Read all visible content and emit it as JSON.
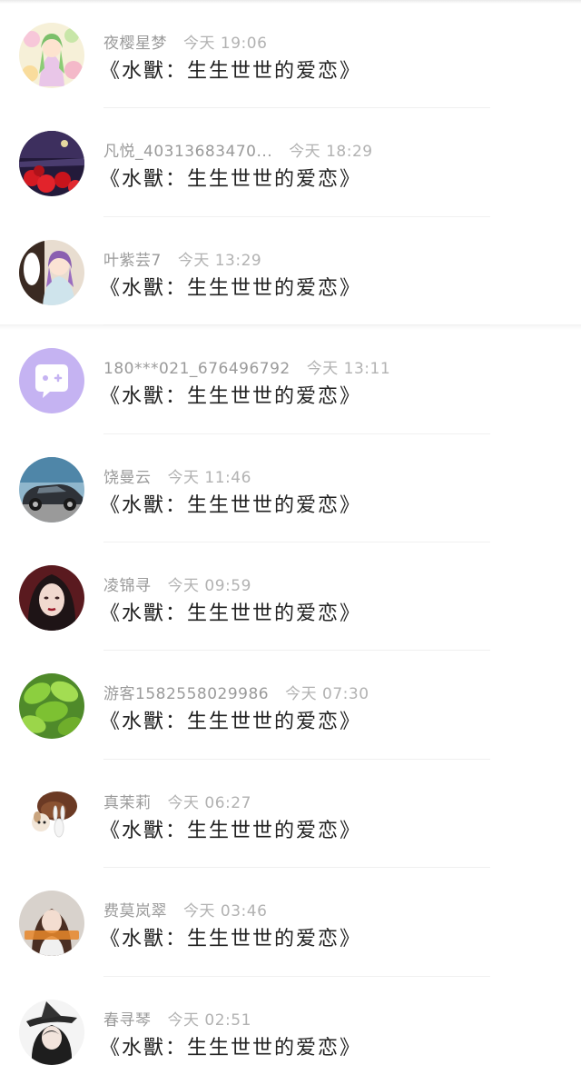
{
  "conversations": [
    {
      "name": "夜樱星梦",
      "time": "今天 19:06",
      "message": "《水獸：生生世世的爱恋》",
      "avatar": "anime-girl-flowers-avatar"
    },
    {
      "name": "凡悦_40313683470...",
      "time": "今天 18:29",
      "message": "《水獸：生生世世的爱恋》",
      "avatar": "red-spider-lily-night-avatar"
    },
    {
      "name": "叶紫芸7",
      "time": "今天 13:29",
      "message": "《水獸：生生世世的爱恋》",
      "avatar": "anime-purple-hair-girl-avatar"
    },
    {
      "name": "180***021_676496792",
      "time": "今天 13:11",
      "message": "《水獸：生生世世的爱恋》",
      "avatar": "default-chat-bubble-avatar"
    },
    {
      "name": "饶曼云",
      "time": "今天 11:46",
      "message": "《水獸：生生世世的爱恋》",
      "avatar": "car-avatar"
    },
    {
      "name": "凌锦寻",
      "time": "今天 09:59",
      "message": "《水獸：生生世世的爱恋》",
      "avatar": "portrait-woman-avatar"
    },
    {
      "name": "游客1582558029986",
      "time": "今天 07:30",
      "message": "《水獸：生生世世的爱恋》",
      "avatar": "green-leaves-avatar"
    },
    {
      "name": "真茉莉",
      "time": "今天 06:27",
      "message": "《水獸：生生世世的爱恋》",
      "avatar": "cartoon-pets-avatar"
    },
    {
      "name": "费莫岚翠",
      "time": "今天 03:46",
      "message": "《水獸：生生世世的爱恋》",
      "avatar": "girl-photo-avatar"
    },
    {
      "name": "春寻琴",
      "time": "今天 02:51",
      "message": "《水獸：生生世世的爱恋》",
      "avatar": "black-hat-character-avatar"
    }
  ],
  "colors": {
    "default_avatar_bg": "#c5b3f2",
    "name_text": "#9a9a9a",
    "message_text": "#222222"
  }
}
